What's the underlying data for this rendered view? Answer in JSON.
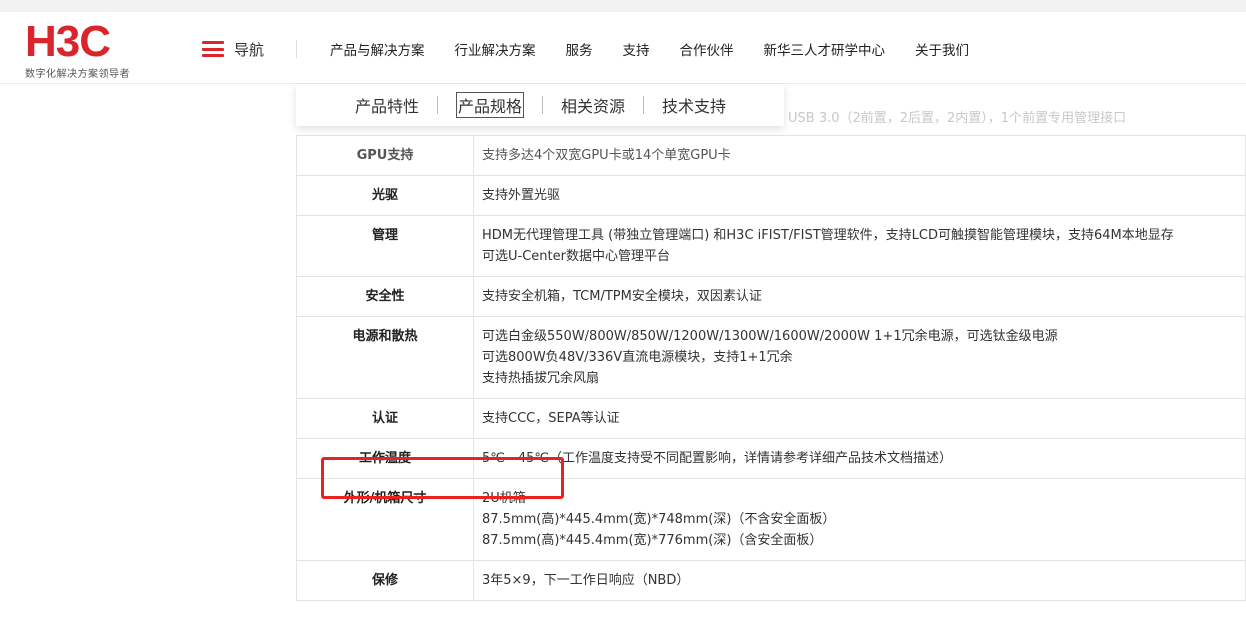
{
  "brand": {
    "logo_text": "H3C",
    "tagline": "数字化解决方案领导者"
  },
  "nav": {
    "toggle_label": "导航",
    "menu": [
      "产品与解决方案",
      "行业解决方案",
      "服务",
      "支持",
      "合作伙伴",
      "新华三人才研学中心",
      "关于我们"
    ]
  },
  "subtabs": {
    "items": [
      "产品特性",
      "产品规格",
      "相关资源",
      "技术支持"
    ],
    "active": "产品规格"
  },
  "ghost_text": "USB 3.0（2前置，2后置，2内置），1个前置专用管理接口",
  "spec_rows": [
    {
      "key": "GPU支持",
      "lines": [
        "支持多达4个双宽GPU卡或14个单宽GPU卡"
      ]
    },
    {
      "key": "光驱",
      "lines": [
        "支持外置光驱"
      ]
    },
    {
      "key": "管理",
      "lines": [
        "HDM无代理管理工具 (带独立管理端口) 和H3C iFIST/FIST管理软件，支持LCD可触摸智能管理模块，支持64M本地显存",
        "可选U-Center数据中心管理平台"
      ]
    },
    {
      "key": "安全性",
      "lines": [
        "支持安全机箱，TCM/TPM安全模块，双因素认证"
      ]
    },
    {
      "key": "电源和散热",
      "lines": [
        "可选白金级550W/800W/850W/1200W/1300W/1600W/2000W 1+1冗余电源，可选钛金级电源",
        "可选800W负48V/336V直流电源模块，支持1+1冗余",
        "支持热插拔冗余风扇"
      ]
    },
    {
      "key": "认证",
      "lines": [
        "支持CCC，SEPA等认证"
      ]
    },
    {
      "key": "工作温度",
      "lines": [
        "5℃ - 45℃（工作温度支持受不同配置影响，详情请参考详细产品技术文档描述）"
      ]
    },
    {
      "key": "外形/机箱尺寸",
      "lines": [
        "2U机箱",
        "87.5mm(高)*445.4mm(宽)*748mm(深)（不含安全面板）",
        "87.5mm(高)*445.4mm(宽)*776mm(深)（含安全面板）"
      ]
    },
    {
      "key": "保修",
      "lines": [
        "3年5×9，下一工作日响应（NBD）"
      ]
    }
  ],
  "colors": {
    "brand_red": "#d9262d",
    "highlight_red": "#e8231f"
  }
}
